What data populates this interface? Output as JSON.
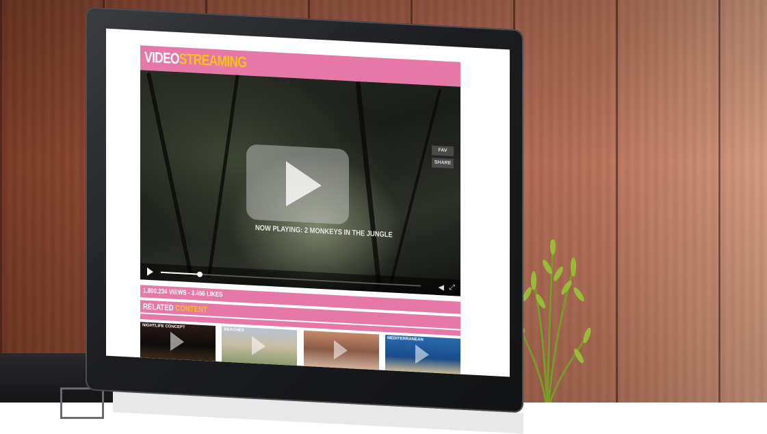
{
  "site": {
    "logo_part1": "VIDEO",
    "logo_part2": "STREAMING"
  },
  "player": {
    "overlay_buttons": [
      "FAV",
      "SHARE"
    ],
    "now_playing": "NOW PLAYING: 2 MONKEYS IN THE JUNGLE",
    "progress_fraction": 0.15
  },
  "stats": {
    "text": "1.800.234 VIEWS - 3.456 LIKES"
  },
  "related": {
    "title_part1": "RELATED",
    "title_part2": "CONTENT",
    "items": [
      {
        "label": "NIGHTLIFE CONCEPT"
      },
      {
        "label": "BEACHES"
      },
      {
        "label": ""
      },
      {
        "label": "MEDITERRANEAN"
      }
    ]
  },
  "colors": {
    "accent_pink": "#e678a8",
    "accent_yellow": "#f5c023"
  }
}
